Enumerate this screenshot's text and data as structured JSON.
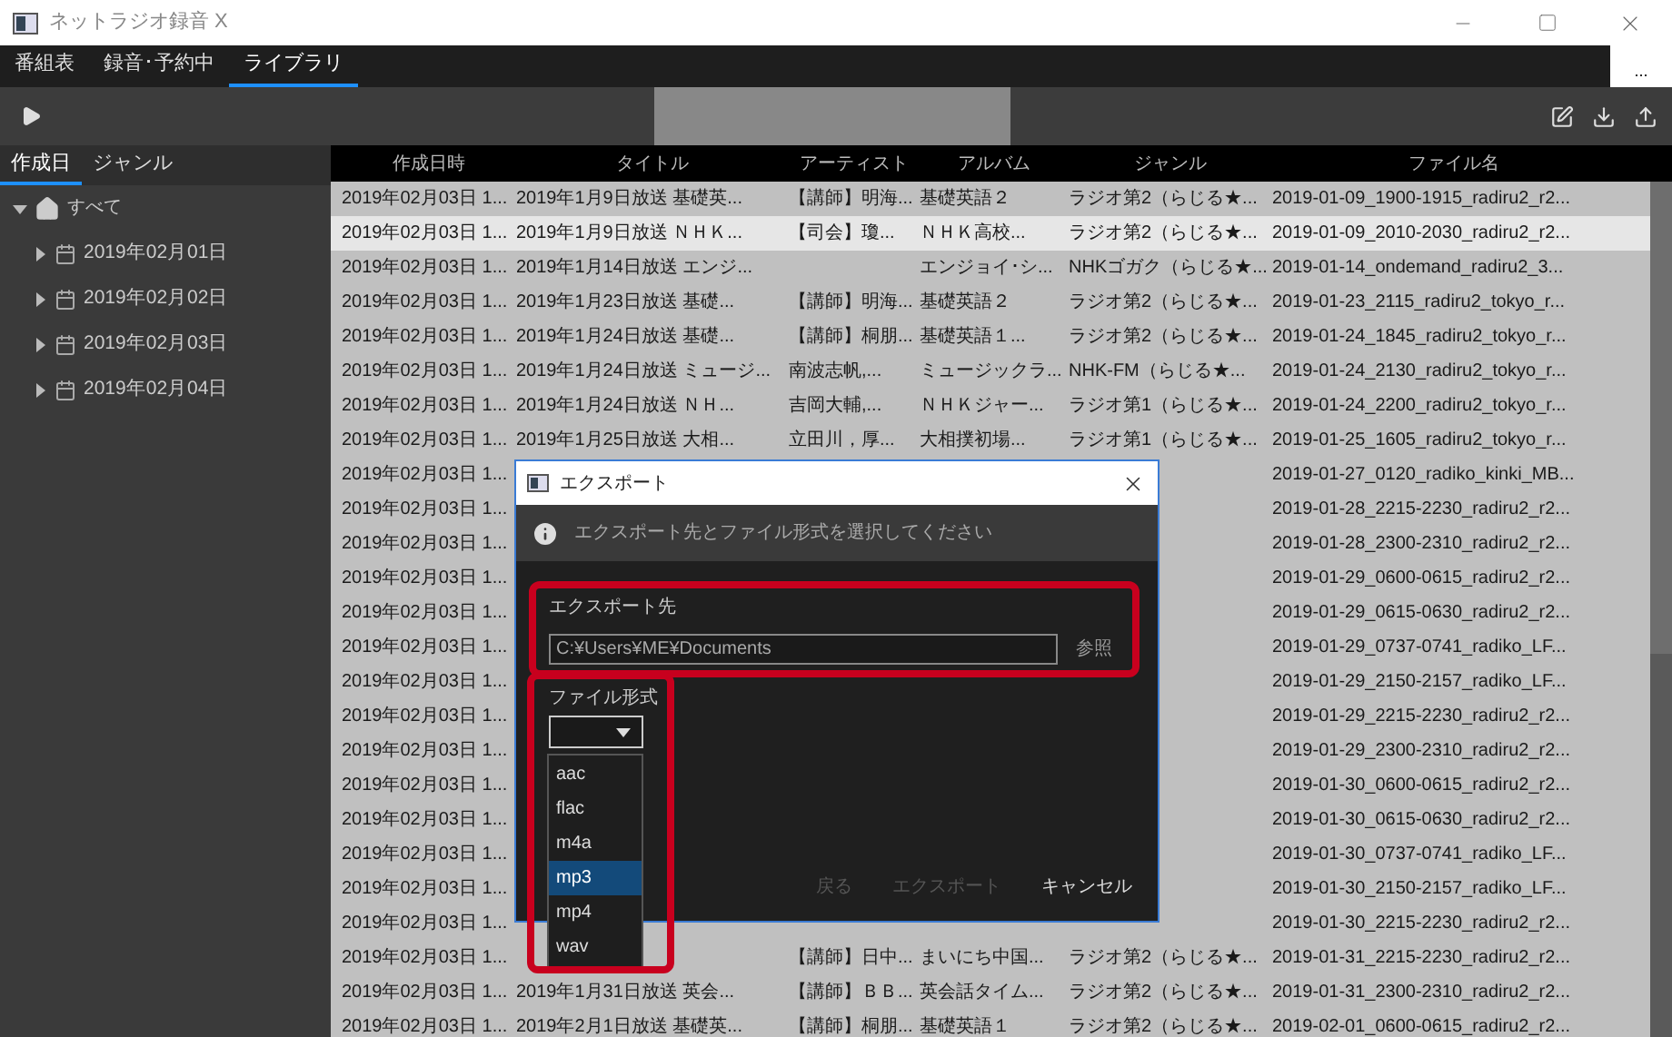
{
  "window": {
    "title": "ネットラジオ録音 X"
  },
  "menu_tabs": [
    {
      "label": "番組表",
      "selected": false
    },
    {
      "label": "録音･予約中",
      "selected": false
    },
    {
      "label": "ライブラリ",
      "selected": true
    }
  ],
  "overflow_button": "...",
  "sidebar": {
    "tabs": [
      {
        "label": "作成日",
        "selected": true
      },
      {
        "label": "ジャンル",
        "selected": false
      }
    ],
    "tree": {
      "label": "すべて",
      "expanded": true,
      "children": [
        {
          "label": "2019年02月01日",
          "expanded": false
        },
        {
          "label": "2019年02月02日",
          "expanded": false
        },
        {
          "label": "2019年02月03日",
          "expanded": false
        },
        {
          "label": "2019年02月04日",
          "expanded": false
        }
      ]
    }
  },
  "table": {
    "columns": [
      "作成日時",
      "タイトル",
      "アーティスト",
      "アルバム",
      "ジャンル",
      "ファイル名"
    ],
    "rows": [
      {
        "selected": false,
        "cells": [
          "2019年02月03日 1...",
          "2019年1月9日放送 基礎英...",
          "【講師】明海...",
          "基礎英語２",
          "ラジオ第2（らじる★...",
          "2019-01-09_1900-1915_radiru2_r2..."
        ]
      },
      {
        "selected": true,
        "cells": [
          "2019年02月03日 1...",
          "2019年1月9日放送 ＮＨＫ...",
          "【司会】瓊...",
          "ＮＨＫ高校...",
          "ラジオ第2（らじる★...",
          "2019-01-09_2010-2030_radiru2_r2..."
        ]
      },
      {
        "selected": false,
        "cells": [
          "2019年02月03日 1...",
          "2019年1月14日放送 エンジ...",
          null,
          "エンジョイ･シ...",
          "NHKゴガク（らじる★...",
          "2019-01-14_ondemand_radiru2_3..."
        ]
      },
      {
        "selected": false,
        "cells": [
          "2019年02月03日 1...",
          "2019年1月23日放送 基礎...",
          "【講師】明海...",
          "基礎英語２",
          "ラジオ第2（らじる★...",
          "2019-01-23_2115_radiru2_tokyo_r..."
        ]
      },
      {
        "selected": false,
        "cells": [
          "2019年02月03日 1...",
          "2019年1月24日放送 基礎...",
          "【講師】桐朋...",
          "基礎英語１...",
          "ラジオ第2（らじる★...",
          "2019-01-24_1845_radiru2_tokyo_r..."
        ]
      },
      {
        "selected": false,
        "cells": [
          "2019年02月03日 1...",
          "2019年1月24日放送 ミュージ...",
          "南波志帆,...",
          "ミュージックラ...",
          "NHK-FM（らじる★...",
          "2019-01-24_2130_radiru2_tokyo_r..."
        ]
      },
      {
        "selected": false,
        "cells": [
          "2019年02月03日 1...",
          "2019年1月24日放送 ＮＨ...",
          "吉岡大輔,...",
          "ＮＨＫジャー...",
          "ラジオ第1（らじる★...",
          "2019-01-24_2200_radiru2_tokyo_r..."
        ]
      },
      {
        "selected": false,
        "cells": [
          "2019年02月03日 1...",
          "2019年1月25日放送 大相...",
          "立田川，厚...",
          "大相撲初場...",
          "ラジオ第1（らじる★...",
          "2019-01-25_1605_radiru2_tokyo_r..."
        ]
      },
      {
        "selected": false,
        "cells": [
          "2019年02月03日 1...",
          null,
          null,
          null,
          null,
          "2019-01-27_0120_radiko_kinki_MB..."
        ]
      },
      {
        "selected": false,
        "cells": [
          "2019年02月03日 1...",
          null,
          null,
          null,
          null,
          "2019-01-28_2215-2230_radiru2_r2..."
        ]
      },
      {
        "selected": false,
        "cells": [
          "2019年02月03日 1...",
          null,
          null,
          null,
          null,
          "2019-01-28_2300-2310_radiru2_r2..."
        ]
      },
      {
        "selected": false,
        "cells": [
          "2019年02月03日 1...",
          null,
          null,
          null,
          null,
          "2019-01-29_0600-0615_radiru2_r2..."
        ]
      },
      {
        "selected": false,
        "cells": [
          "2019年02月03日 1...",
          null,
          null,
          null,
          null,
          "2019-01-29_0615-0630_radiru2_r2..."
        ]
      },
      {
        "selected": false,
        "cells": [
          "2019年02月03日 1...",
          null,
          null,
          null,
          null,
          "2019-01-29_0737-0741_radiko_LF..."
        ]
      },
      {
        "selected": false,
        "cells": [
          "2019年02月03日 1...",
          null,
          null,
          null,
          null,
          "2019-01-29_2150-2157_radiko_LF..."
        ]
      },
      {
        "selected": false,
        "cells": [
          "2019年02月03日 1...",
          null,
          null,
          null,
          null,
          "2019-01-29_2215-2230_radiru2_r2..."
        ]
      },
      {
        "selected": false,
        "cells": [
          "2019年02月03日 1...",
          null,
          null,
          null,
          null,
          "2019-01-29_2300-2310_radiru2_r2..."
        ]
      },
      {
        "selected": false,
        "cells": [
          "2019年02月03日 1...",
          null,
          null,
          null,
          null,
          "2019-01-30_0600-0615_radiru2_r2..."
        ]
      },
      {
        "selected": false,
        "cells": [
          "2019年02月03日 1...",
          null,
          null,
          null,
          null,
          "2019-01-30_0615-0630_radiru2_r2..."
        ]
      },
      {
        "selected": false,
        "cells": [
          "2019年02月03日 1...",
          null,
          null,
          null,
          null,
          "2019-01-30_0737-0741_radiko_LF..."
        ]
      },
      {
        "selected": false,
        "cells": [
          "2019年02月03日 1...",
          null,
          null,
          null,
          null,
          "2019-01-30_2150-2157_radiko_LF..."
        ]
      },
      {
        "selected": false,
        "cells": [
          "2019年02月03日 1...",
          null,
          null,
          null,
          null,
          "2019-01-30_2215-2230_radiru2_r2..."
        ]
      },
      {
        "selected": false,
        "cells": [
          "2019年02月03日 1...",
          null,
          "【講師】日中...",
          "まいにち中国...",
          "ラジオ第2（らじる★...",
          "2019-01-31_2215-2230_radiru2_r2..."
        ]
      },
      {
        "selected": false,
        "cells": [
          "2019年02月03日 1...",
          "2019年1月31日放送 英会...",
          "【講師】ＢＢ...",
          "英会話タイム...",
          "ラジオ第2（らじる★...",
          "2019-01-31_2300-2310_radiru2_r2..."
        ]
      },
      {
        "selected": false,
        "cells": [
          "2019年02月03日 1...",
          "2019年2月1日放送 基礎英...",
          "【講師】桐朋...",
          "基礎英語１",
          "ラジオ第2（らじる★...",
          "2019-02-01_0600-0615_radiru2_r2..."
        ]
      }
    ]
  },
  "dialog": {
    "title": "エクスポート",
    "info": "エクスポート先とファイル形式を選択してください",
    "destination_label": "エクスポート先",
    "destination_value": "C:¥Users¥ME¥Documents",
    "browse_button": "参照",
    "format_label": "ファイル形式",
    "format_options": [
      {
        "label": "aac",
        "selected": false
      },
      {
        "label": "flac",
        "selected": false
      },
      {
        "label": "m4a",
        "selected": false
      },
      {
        "label": "mp3",
        "selected": true
      },
      {
        "label": "mp4",
        "selected": false
      },
      {
        "label": "wav",
        "selected": false
      }
    ],
    "buttons": [
      {
        "label": "戻る",
        "disabled": true
      },
      {
        "label": "エクスポート",
        "disabled": true
      },
      {
        "label": "キャンセル",
        "disabled": false
      }
    ]
  }
}
